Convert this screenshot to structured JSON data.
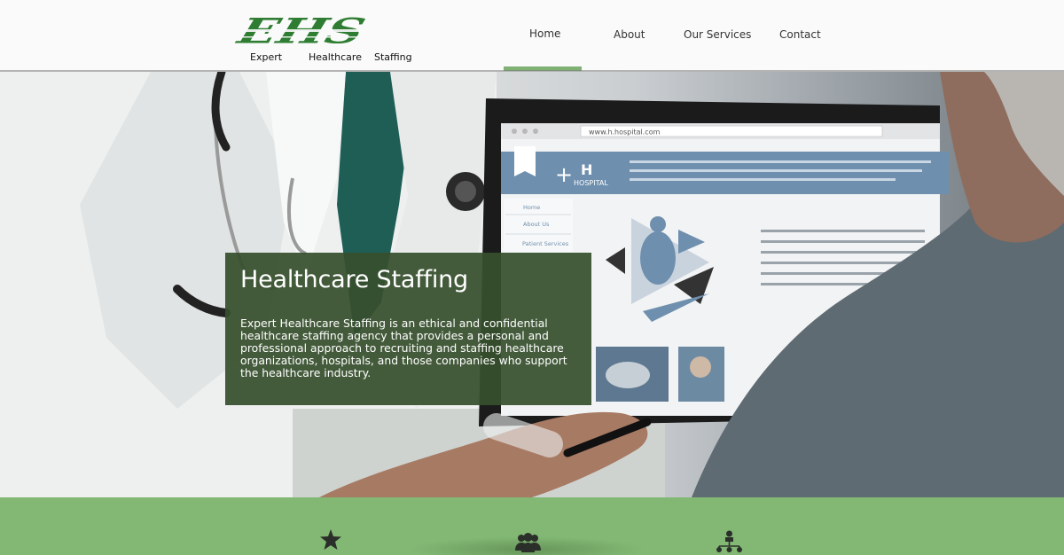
{
  "logo": {
    "mark": "EHS",
    "words": [
      "Expert",
      "Healthcare",
      "Staffing"
    ]
  },
  "nav": {
    "items": [
      {
        "label": "Home",
        "active": true
      },
      {
        "label": "About",
        "active": false
      },
      {
        "label": "Our Services",
        "active": false
      },
      {
        "label": "Contact",
        "active": false
      }
    ]
  },
  "hero": {
    "title": "Healthcare Staffing",
    "description": "Expert Healthcare Staffing is an ethical and confidential healthcare staffing agency that provides a personal and professional approach to recruiting and staffing healthcare organizations, hospitals, and those companies who support the healthcare industry.",
    "laptop_screen": {
      "url": "www.h.hospital.com",
      "brand": "HOSPITAL",
      "menu": [
        "Home",
        "About Us",
        "Patient Services"
      ]
    }
  },
  "features": {
    "icons": [
      "star-icon",
      "group-icon",
      "network-icon"
    ]
  },
  "colors": {
    "brand_green": "#2e7d32",
    "accent_green": "#82b874",
    "card_green": "#37502d",
    "header_bg": "#f9faf9"
  }
}
